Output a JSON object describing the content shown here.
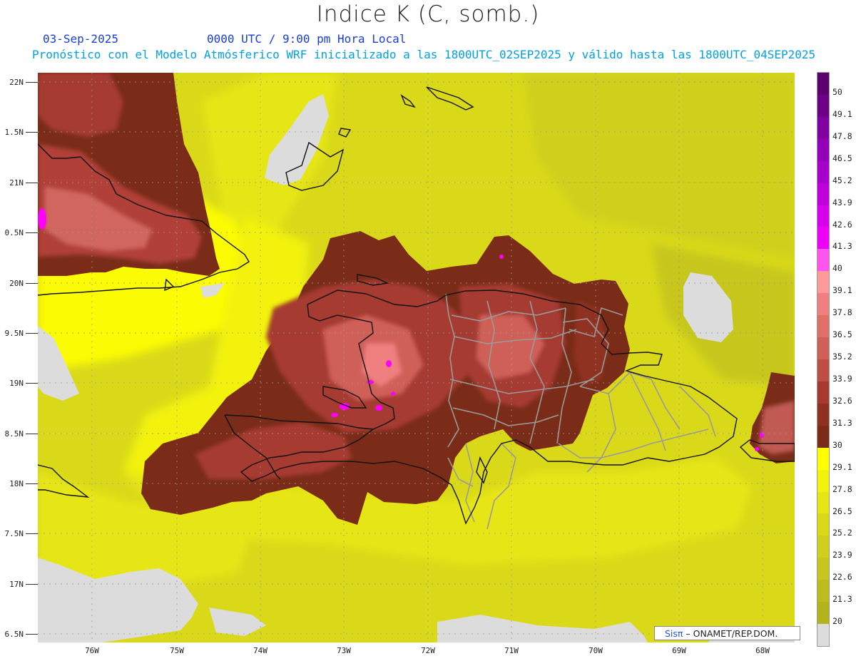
{
  "title": "Indice K (C, somb.)",
  "date": "03-Sep-2025",
  "time_label": "0000 UTC / 9:00 pm Hora Local",
  "forecast_line": "Pronóstico con el Modelo Atmósferico WRF inicializado a las 1800UTC_02SEP2025 y válido hasta las  1800UTC_04SEP2025",
  "credit": {
    "logo": "Sis",
    "pi": "π",
    "text": "– ONAMET/REP.DOM."
  },
  "lat_labels": [
    "22N",
    "1.5N",
    "21N",
    "0.5N",
    "20N",
    "9.5N",
    "19N",
    "8.5N",
    "18N",
    "7.5N",
    "17N",
    "6.5N"
  ],
  "lon_labels": [
    "76W",
    "75W",
    "74W",
    "73W",
    "72W",
    "71W",
    "70W",
    "69W",
    "68W"
  ],
  "colorbar": {
    "labels": [
      "50",
      "49.1",
      "47.8",
      "46.5",
      "45.2",
      "43.9",
      "42.6",
      "41.3",
      "40",
      "39.1",
      "37.8",
      "36.5",
      "35.2",
      "33.9",
      "32.6",
      "31.3",
      "30",
      "29.1",
      "27.8",
      "26.5",
      "25.2",
      "23.9",
      "22.6",
      "21.3",
      "20"
    ],
    "colors": [
      "#5c0070",
      "#6e0088",
      "#8000a0",
      "#9400b8",
      "#a800cc",
      "#c000dc",
      "#d600ea",
      "#ee00f6",
      "#ff55ee",
      "#ff9a9a",
      "#f08080",
      "#df7068",
      "#cf6058",
      "#bd4e44",
      "#a63a30",
      "#903020",
      "#7a2c18",
      "#ffff00",
      "#f2f20c",
      "#e6e614",
      "#d9d91a",
      "#cfcf1c",
      "#c6c61e",
      "#bcbc1e",
      "#b3b31c",
      "#dcdcdc"
    ]
  }
}
